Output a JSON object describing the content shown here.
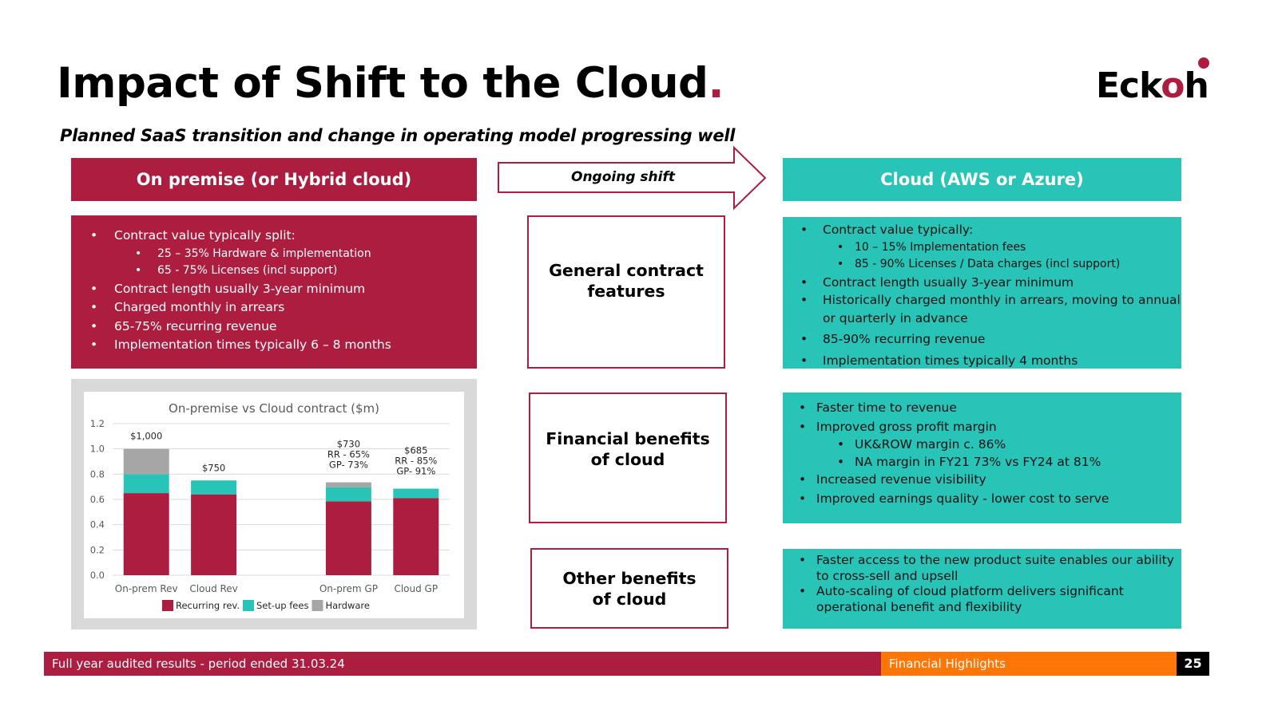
{
  "header": {
    "title": "Impact of Shift to the Cloud",
    "title_dot": ".",
    "subtitle": "Planned SaaS transition and change in operating model progressing well",
    "logo": {
      "prefix": "Eck",
      "accent": "o",
      "suffix": "h"
    }
  },
  "colors": {
    "crimson": "#ad1d40",
    "teal": "#29c4b8",
    "orange": "#ff7606",
    "hardware_grey": "#a6a6a6"
  },
  "left_column": {
    "header": "On premise (or Hybrid cloud)",
    "bullets": [
      {
        "text": "Contract value typically split:",
        "level": 1
      },
      {
        "text": "25 – 35% Hardware & implementation",
        "level": 2
      },
      {
        "text": "65 - 75%  Licenses (incl support)",
        "level": 2
      },
      {
        "text": "Contract length usually 3-year minimum",
        "level": 1
      },
      {
        "text": "Charged monthly in arrears",
        "level": 1
      },
      {
        "text": "65-75% recurring revenue",
        "level": 1
      },
      {
        "text": "Implementation times typically 6 – 8 months",
        "level": 1
      }
    ]
  },
  "middle_column": {
    "arrow_label": "Ongoing shift",
    "boxes": [
      {
        "line1": "General contract",
        "line2": "features"
      },
      {
        "line1": "Financial benefits",
        "line2": "of cloud"
      },
      {
        "line1": "Other benefits",
        "line2": "of cloud"
      }
    ]
  },
  "right_column": {
    "header": "Cloud (AWS or Azure)",
    "general": [
      {
        "text": "Contract value typically:",
        "level": 1
      },
      {
        "text": "10 – 15% Implementation fees",
        "level": 2
      },
      {
        "text": "85 - 90% Licenses / Data charges (incl support)",
        "level": 2
      },
      {
        "text": "Contract length usually 3-year minimum",
        "level": 1
      },
      {
        "text": "Historically charged monthly in arrears, moving to annual or quarterly in advance",
        "level": 1
      },
      {
        "text": "85-90% recurring revenue",
        "level": 1
      },
      {
        "text": "Implementation times typically 4 months",
        "level": 1
      }
    ],
    "financial": [
      {
        "text": "Faster time to revenue",
        "level": 1
      },
      {
        "text": "Improved gross profit margin",
        "level": 1
      },
      {
        "text": "UK&ROW margin c. 86%",
        "level": 2
      },
      {
        "text": "NA margin in FY21 73% vs FY24 at 81%",
        "level": 2
      },
      {
        "text": "Increased revenue visibility",
        "level": 1
      },
      {
        "text": "Improved earnings quality - lower cost to serve",
        "level": 1
      }
    ],
    "other": [
      {
        "text": "Faster access to the new product suite enables our ability to cross-sell and upsell",
        "level": 1
      },
      {
        "text": "Auto-scaling of cloud platform delivers significant operational benefit and flexibility",
        "level": 1
      }
    ]
  },
  "chart_data": {
    "type": "bar",
    "stacked": true,
    "title": "On-premise vs Cloud contract ($m)",
    "xlabel": "",
    "ylabel": "",
    "ylim": [
      0,
      1.2
    ],
    "yticks": [
      "0.0",
      "0.2",
      "0.4",
      "0.6",
      "0.8",
      "1.0",
      "1.2"
    ],
    "ytick_values": [
      0,
      0.2,
      0.4,
      0.6,
      0.8,
      1.0,
      1.2
    ],
    "grid": true,
    "legend_position": "bottom",
    "categories": [
      "On-prem Rev",
      "Cloud Rev",
      "",
      "On-prem GP",
      "Cloud GP"
    ],
    "series": [
      {
        "name": "Recurring rev.",
        "color": "#ad1d40",
        "values": [
          0.65,
          0.64,
          0,
          0.585,
          0.61
        ]
      },
      {
        "name": "Set-up fees",
        "color": "#29c4b8",
        "values": [
          0.15,
          0.11,
          0,
          0.11,
          0.075
        ]
      },
      {
        "name": "Hardware",
        "color": "#a6a6a6",
        "values": [
          0.2,
          0,
          0,
          0.04,
          0
        ]
      }
    ],
    "annotations": [
      [
        "$1,000"
      ],
      [
        "$750"
      ],
      [],
      [
        "$730",
        "RR - 65%",
        "GP- 73%"
      ],
      [
        "$685",
        "RR - 85%",
        "GP- 91%"
      ]
    ]
  },
  "footer": {
    "left": "Full year audited results - period ended 31.03.24",
    "section": "Financial Highlights",
    "page": "25"
  }
}
